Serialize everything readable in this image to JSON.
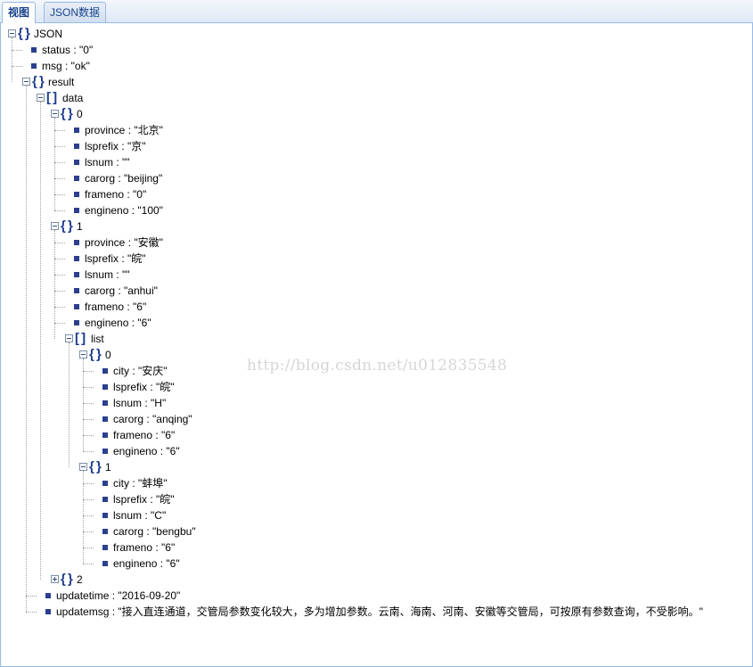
{
  "tabs": [
    {
      "label": "视图",
      "active": true
    },
    {
      "label": "JSON数据",
      "active": false
    }
  ],
  "tree": [
    {
      "d": 0,
      "type": "object",
      "label": "JSON",
      "expanded": true
    },
    {
      "d": 1,
      "type": "leaf",
      "label": "status : \"0\""
    },
    {
      "d": 1,
      "type": "leaf",
      "label": "msg : \"ok\""
    },
    {
      "d": 1,
      "type": "object",
      "label": "result",
      "expanded": true
    },
    {
      "d": 2,
      "type": "array",
      "label": "data",
      "expanded": true
    },
    {
      "d": 3,
      "type": "object",
      "label": "0",
      "expanded": true
    },
    {
      "d": 4,
      "type": "leaf",
      "label": "province : \"北京\""
    },
    {
      "d": 4,
      "type": "leaf",
      "label": "lsprefix : \"京\""
    },
    {
      "d": 4,
      "type": "leaf",
      "label": "lsnum : \"\""
    },
    {
      "d": 4,
      "type": "leaf",
      "label": "carorg : \"beijing\""
    },
    {
      "d": 4,
      "type": "leaf",
      "label": "frameno : \"0\""
    },
    {
      "d": 4,
      "type": "leaf",
      "label": "engineno : \"100\""
    },
    {
      "d": 3,
      "type": "object",
      "label": "1",
      "expanded": true
    },
    {
      "d": 4,
      "type": "leaf",
      "label": "province : \"安徽\""
    },
    {
      "d": 4,
      "type": "leaf",
      "label": "lsprefix : \"皖\""
    },
    {
      "d": 4,
      "type": "leaf",
      "label": "lsnum : \"\""
    },
    {
      "d": 4,
      "type": "leaf",
      "label": "carorg : \"anhui\""
    },
    {
      "d": 4,
      "type": "leaf",
      "label": "frameno : \"6\""
    },
    {
      "d": 4,
      "type": "leaf",
      "label": "engineno : \"6\""
    },
    {
      "d": 4,
      "type": "array",
      "label": "list",
      "expanded": true
    },
    {
      "d": 5,
      "type": "object",
      "label": "0",
      "expanded": true
    },
    {
      "d": 6,
      "type": "leaf",
      "label": "city : \"安庆\""
    },
    {
      "d": 6,
      "type": "leaf",
      "label": "lsprefix : \"皖\""
    },
    {
      "d": 6,
      "type": "leaf",
      "label": "lsnum : \"H\""
    },
    {
      "d": 6,
      "type": "leaf",
      "label": "carorg : \"anqing\""
    },
    {
      "d": 6,
      "type": "leaf",
      "label": "frameno : \"6\""
    },
    {
      "d": 6,
      "type": "leaf",
      "label": "engineno : \"6\""
    },
    {
      "d": 5,
      "type": "object",
      "label": "1",
      "expanded": true
    },
    {
      "d": 6,
      "type": "leaf",
      "label": "city : \"蚌埠\""
    },
    {
      "d": 6,
      "type": "leaf",
      "label": "lsprefix : \"皖\""
    },
    {
      "d": 6,
      "type": "leaf",
      "label": "lsnum : \"C\""
    },
    {
      "d": 6,
      "type": "leaf",
      "label": "carorg : \"bengbu\""
    },
    {
      "d": 6,
      "type": "leaf",
      "label": "frameno : \"6\""
    },
    {
      "d": 6,
      "type": "leaf",
      "label": "engineno : \"6\""
    },
    {
      "d": 3,
      "type": "object",
      "label": "2",
      "expanded": false
    },
    {
      "d": 2,
      "type": "leaf",
      "label": "updatetime : \"2016-09-20\""
    },
    {
      "d": 2,
      "type": "leaf",
      "label": "updatemsg : \"接入直连通道，交管局参数变化较大，多为增加参数。云南、海南、河南、安徽等交管局，可按原有参数查询，不受影响。\""
    }
  ],
  "watermark": "http://blog.csdn.net/u012835548"
}
